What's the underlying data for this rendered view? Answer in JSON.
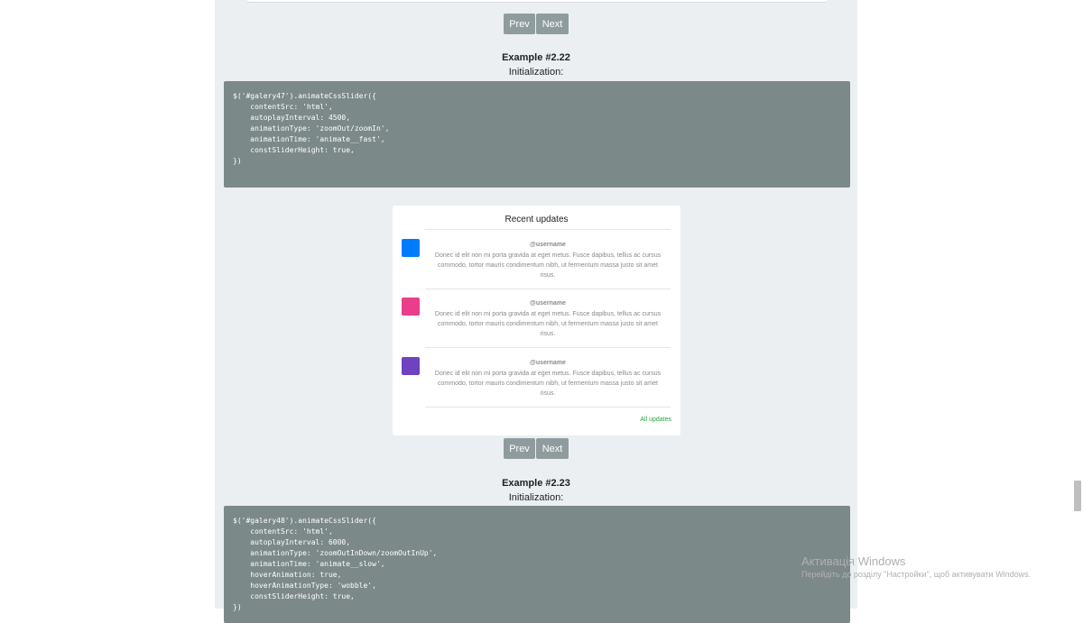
{
  "pager": {
    "prev_label": "Prev",
    "next_label": "Next"
  },
  "example_22": {
    "title": "Example #2.22",
    "init_label": "Initialization:",
    "code_lines": [
      "$('#galery47').animateCssSlider({",
      "    contentSrc: 'html',",
      "    autoplayInterval: 4500,",
      "    animationType: 'zoomOut/zoomIn',",
      "    animationTime: 'animate__fast',",
      "    constSliderHeight: true,",
      "})"
    ]
  },
  "recent_updates": {
    "title": "Recent updates",
    "items": [
      {
        "avatar_color": "#007bff",
        "username": "@username",
        "message": "Donec id elit non mi porta gravida at eget metus. Fusce dapibus, tellus ac cursus commodo, tortor mauris condimentum nibh, ut fermentum massa justo sit amet risus."
      },
      {
        "avatar_color": "#e83e8c",
        "username": "@username",
        "message": "Donec id elit non mi porta gravida at eget metus. Fusce dapibus, tellus ac cursus commodo, tortor mauris condimentum nibh, ut fermentum massa justo sit amet risus."
      },
      {
        "avatar_color": "#6f42c1",
        "username": "@username",
        "message": "Donec id elit non mi porta gravida at eget metus. Fusce dapibus, tellus ac cursus commodo, tortor mauris condimentum nibh, ut fermentum massa justo sit amet risus."
      }
    ],
    "all_updates_label": "All updates"
  },
  "example_23": {
    "title": "Example #2.23",
    "init_label": "Initialization:",
    "code_lines": [
      "$('#galery48').animateCssSlider({",
      "    contentSrc: 'html',",
      "    autoplayInterval: 6000,",
      "    animationType: 'zoomOutInDown/zoomOutInUp',",
      "    animationTime: 'animate__slow',",
      "    hoverAnimation: true,",
      "    hoverAnimationType: 'wobble',",
      "    constSliderHeight: true,",
      "})"
    ]
  },
  "windows_activation": {
    "title": "Активація Windows",
    "subtitle": "Перейдіть до розділу \"Настройки\", щоб активувати Windows."
  },
  "colors": {
    "column_background": "#eceff1",
    "code_background": "#7c8989",
    "button_background": "#8f9c9e",
    "link_green": "#28a745"
  }
}
